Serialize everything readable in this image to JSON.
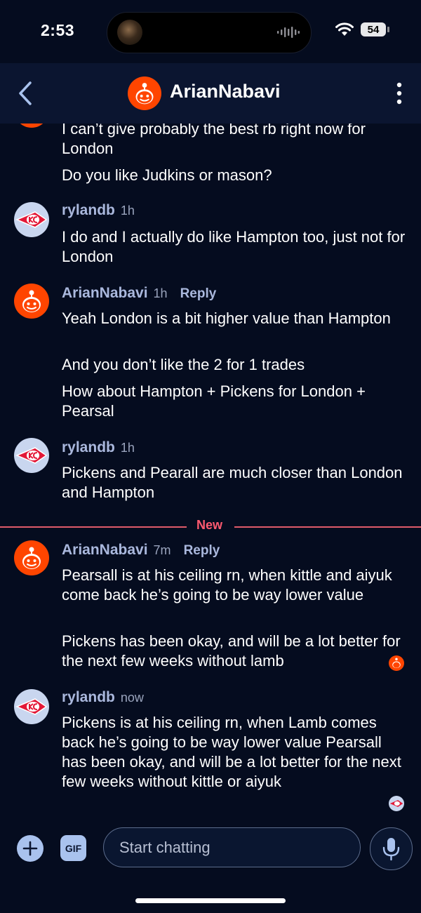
{
  "status_bar": {
    "time": "2:53",
    "battery": "54",
    "icons": [
      "wifi-icon",
      "battery-icon",
      "voice-wave-icon"
    ]
  },
  "header": {
    "title": "ArianNabavi",
    "back_icon": "chevron-left-icon",
    "menu_icon": "kebab-menu-icon"
  },
  "colors": {
    "background": "#050c1f",
    "header": "#0b1530",
    "username": "#aab8dd",
    "new_marker": "#ff5a70",
    "snoo_orange": "#ff4500",
    "composer_button": "#a9c2ee"
  },
  "new_divider_label": "New",
  "messages": [
    {
      "lines": [
        "I can’t give probably the best rb right now for London",
        "Do you like Judkins or mason?"
      ]
    },
    {
      "user": "rylandb",
      "time": "1h",
      "lines": [
        "I do and I actually do like Hampton too, just not for London"
      ]
    },
    {
      "user": "ArianNabavi",
      "time": "1h",
      "reply": "Reply",
      "lines": [
        "Yeah London is a bit higher value than Hampton",
        "And you don’t like the 2 for 1 trades",
        "How about Hampton + Pickens for London + Pearsal"
      ]
    },
    {
      "user": "rylandb",
      "time": "1h",
      "lines": [
        "Pickens and Pearall are much closer than London and Hampton"
      ]
    },
    {
      "user": "ArianNabavi",
      "time": "7m",
      "reply": "Reply",
      "lines": [
        "Pearsall is at his ceiling rn, when kittle and aiyuk come back he’s going to be way lower value",
        "Pickens has been okay, and will be a lot better for the next few weeks without lamb"
      ]
    },
    {
      "user": "rylandb",
      "time": "now",
      "lines": [
        "Pickens is at his ceiling rn, when Lamb comes back he’s going to be way lower value Pearsall has been okay, and will be a lot better for the next few weeks without kittle or aiyuk"
      ]
    }
  ],
  "composer": {
    "placeholder": "Start chatting",
    "gif_label": "GIF",
    "plus_icon": "plus-icon",
    "mic_icon": "microphone-icon"
  }
}
